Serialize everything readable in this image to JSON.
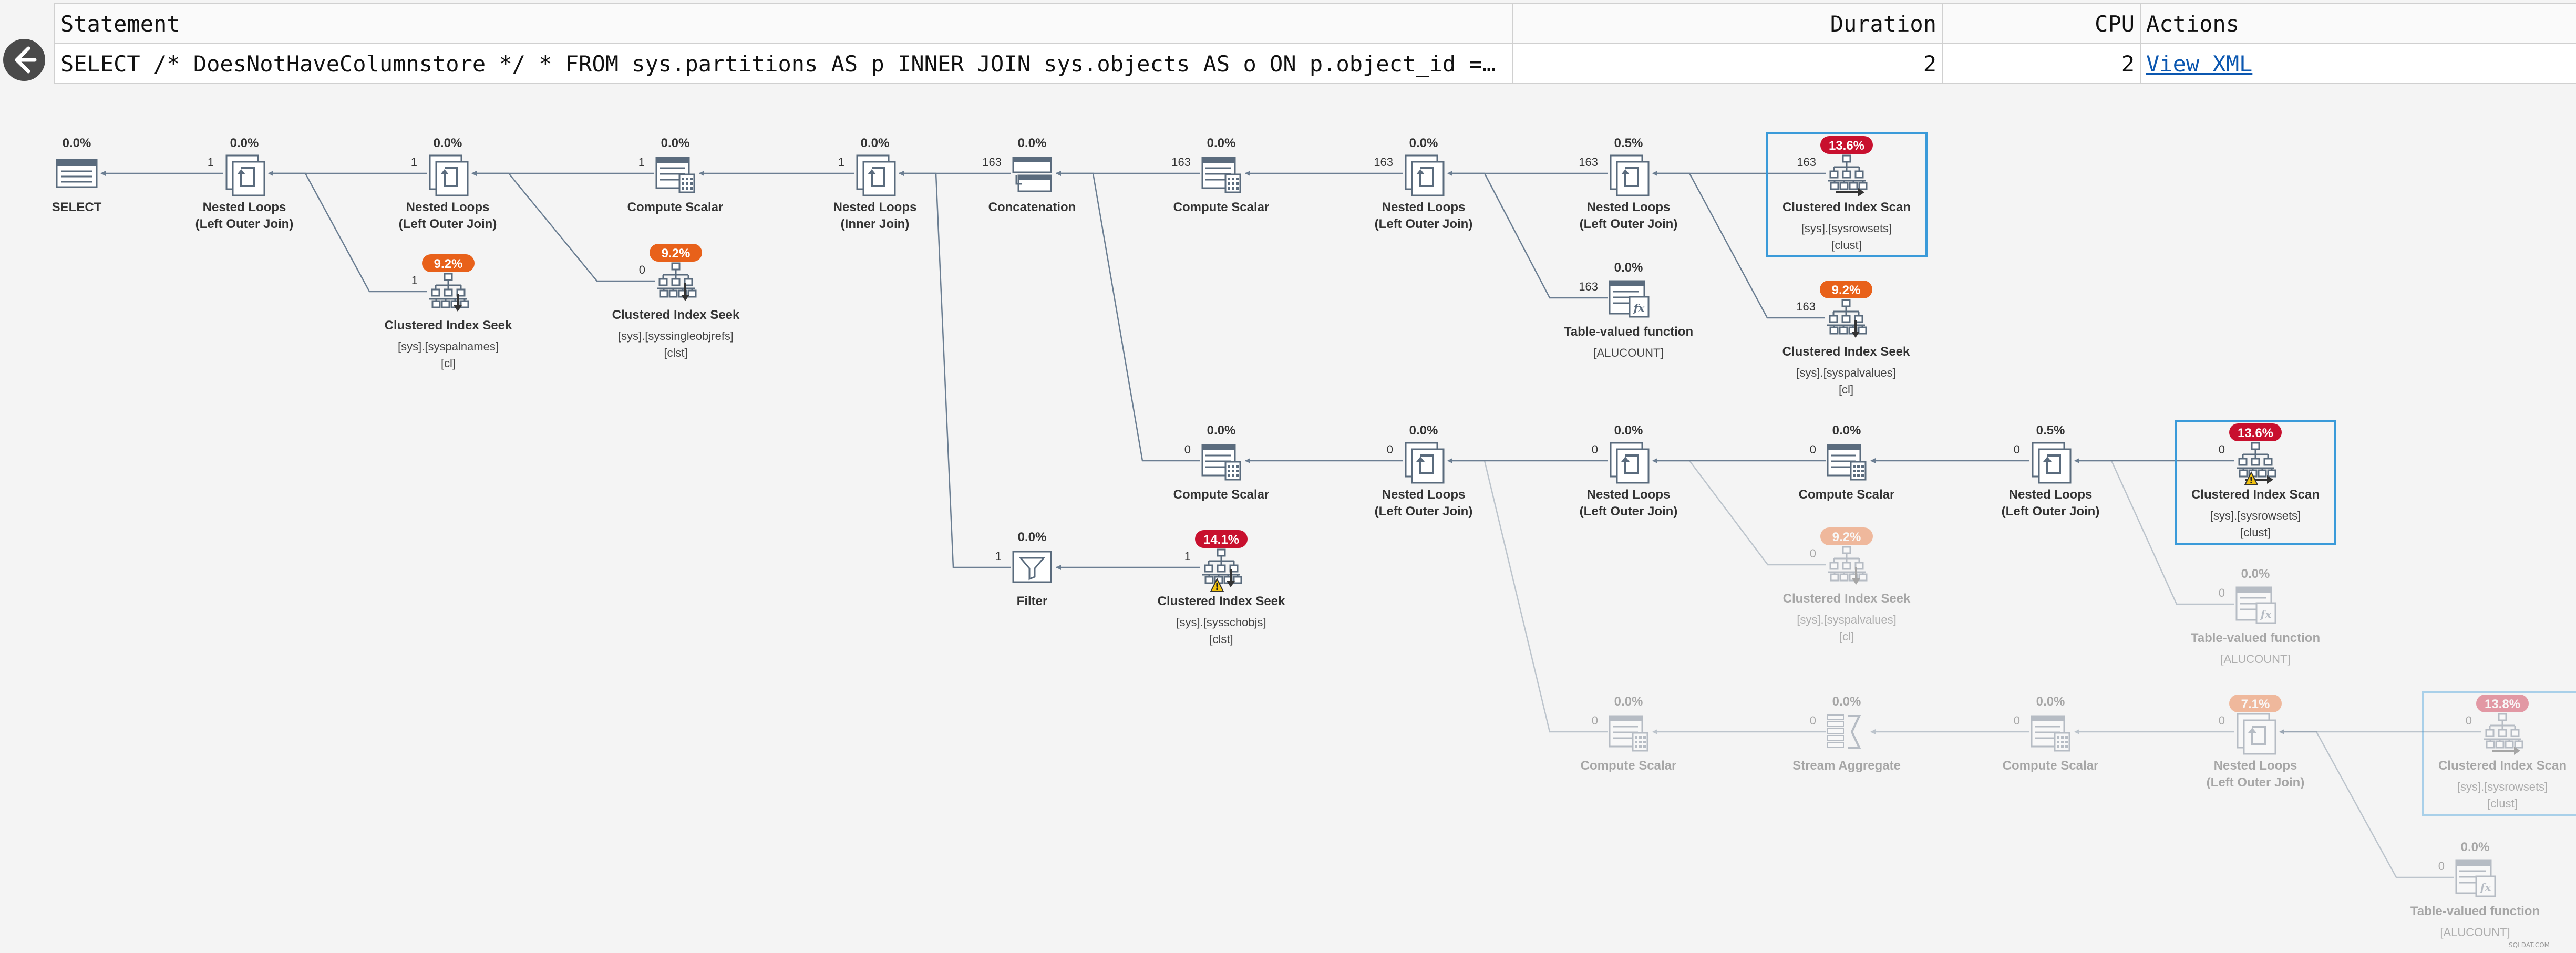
{
  "statement_table": {
    "headers": {
      "statement": "Statement",
      "duration": "Duration",
      "cpu": "CPU",
      "actions": "Actions"
    },
    "row": {
      "statement": "SELECT /* DoesNotHaveColumnstore */ * FROM sys.partitions AS p INNER JOIN sys.objects AS o ON p.object_id = o.object_id …",
      "duration": "2",
      "cpu": "2",
      "action_link": "View XML"
    }
  },
  "colors": {
    "badge_red": "#c8102e",
    "badge_orange": "#e8611a",
    "highlight_border": "#3a9ad9",
    "edge": "#6b7e92",
    "icon_stroke": "#5a6b7d"
  },
  "watermark": "SQLDAT.COM",
  "nodes": [
    {
      "id": "select",
      "icon": "select-icon",
      "pct": "0.0%",
      "lines": [
        "SELECT"
      ],
      "details": []
    },
    {
      "id": "nl1",
      "icon": "nested-loops-icon",
      "pct": "0.0%",
      "lines": [
        "Nested Loops",
        "(Left Outer Join)"
      ],
      "details": []
    },
    {
      "id": "nl2",
      "icon": "nested-loops-icon",
      "pct": "0.0%",
      "lines": [
        "Nested Loops",
        "(Left Outer Join)"
      ],
      "details": []
    },
    {
      "id": "cs1",
      "icon": "compute-scalar-icon",
      "pct": "0.0%",
      "lines": [
        "Compute Scalar"
      ],
      "details": []
    },
    {
      "id": "nl3",
      "icon": "nested-loops-icon",
      "pct": "0.0%",
      "lines": [
        "Nested Loops",
        "(Inner Join)"
      ],
      "details": []
    },
    {
      "id": "concat",
      "icon": "concatenation-icon",
      "pct": "0.0%",
      "lines": [
        "Concatenation"
      ],
      "details": []
    },
    {
      "id": "cs2",
      "icon": "compute-scalar-icon",
      "pct": "0.0%",
      "lines": [
        "Compute Scalar"
      ],
      "details": []
    },
    {
      "id": "nl4",
      "icon": "nested-loops-icon",
      "pct": "0.0%",
      "lines": [
        "Nested Loops",
        "(Left Outer Join)"
      ],
      "details": []
    },
    {
      "id": "nl5",
      "icon": "nested-loops-icon",
      "pct": "0.5%",
      "lines": [
        "Nested Loops",
        "(Left Outer Join)"
      ],
      "details": []
    },
    {
      "id": "cis1",
      "icon": "clustered-index-scan-icon",
      "pct": "13.6%",
      "badge": "red",
      "highlight": true,
      "lines": [
        "Clustered Index Scan"
      ],
      "details": [
        "[sys].[sysrowsets]",
        "[clust]"
      ]
    },
    {
      "id": "seek1",
      "icon": "clustered-index-seek-icon",
      "pct": "9.2%",
      "badge": "orange",
      "lines": [
        "Clustered Index Seek"
      ],
      "details": [
        "[sys].[syspalnames]",
        "[cl]"
      ]
    },
    {
      "id": "seek2",
      "icon": "clustered-index-seek-icon",
      "pct": "9.2%",
      "badge": "orange",
      "lines": [
        "Clustered Index Seek"
      ],
      "details": [
        "[sys].[syssingleobjrefs]",
        "[clst]"
      ]
    },
    {
      "id": "tvf1",
      "icon": "table-valued-function-icon",
      "pct": "0.0%",
      "lines": [
        "Table-valued function"
      ],
      "details": [
        "[ALUCOUNT]"
      ]
    },
    {
      "id": "seek3",
      "icon": "clustered-index-seek-icon",
      "pct": "9.2%",
      "badge": "orange",
      "lines": [
        "Clustered Index Seek"
      ],
      "details": [
        "[sys].[syspalvalues]",
        "[cl]"
      ]
    },
    {
      "id": "cs3",
      "icon": "compute-scalar-icon",
      "pct": "0.0%",
      "lines": [
        "Compute Scalar"
      ],
      "details": []
    },
    {
      "id": "nl6",
      "icon": "nested-loops-icon",
      "pct": "0.0%",
      "lines": [
        "Nested Loops",
        "(Left Outer Join)"
      ],
      "details": []
    },
    {
      "id": "nl7",
      "icon": "nested-loops-icon",
      "pct": "0.0%",
      "lines": [
        "Nested Loops",
        "(Left Outer Join)"
      ],
      "details": []
    },
    {
      "id": "cs4",
      "icon": "compute-scalar-icon",
      "pct": "0.0%",
      "lines": [
        "Compute Scalar"
      ],
      "details": []
    },
    {
      "id": "nl8",
      "icon": "nested-loops-icon",
      "pct": "0.5%",
      "lines": [
        "Nested Loops",
        "(Left Outer Join)"
      ],
      "details": []
    },
    {
      "id": "cis2",
      "icon": "clustered-index-scan-icon",
      "pct": "13.6%",
      "badge": "red",
      "highlight": true,
      "warning": true,
      "lines": [
        "Clustered Index Scan"
      ],
      "details": [
        "[sys].[sysrowsets]",
        "[clust]"
      ]
    },
    {
      "id": "filter",
      "icon": "filter-icon",
      "pct": "0.0%",
      "lines": [
        "Filter"
      ],
      "details": []
    },
    {
      "id": "seek4",
      "icon": "clustered-index-seek-icon",
      "pct": "14.1%",
      "badge": "red",
      "warning": true,
      "lines": [
        "Clustered Index Seek"
      ],
      "details": [
        "[sys].[sysschobjs]",
        "[clst]"
      ]
    },
    {
      "id": "seek5",
      "icon": "clustered-index-seek-icon",
      "pct": "9.2%",
      "badge": "orange",
      "faded": true,
      "lines": [
        "Clustered Index Seek"
      ],
      "details": [
        "[sys].[syspalvalues]",
        "[cl]"
      ]
    },
    {
      "id": "tvf2",
      "icon": "table-valued-function-icon",
      "pct": "0.0%",
      "faded": true,
      "lines": [
        "Table-valued function"
      ],
      "details": [
        "[ALUCOUNT]"
      ]
    },
    {
      "id": "cs5",
      "icon": "compute-scalar-icon",
      "pct": "0.0%",
      "faded": true,
      "lines": [
        "Compute Scalar"
      ],
      "details": []
    },
    {
      "id": "sa",
      "icon": "stream-aggregate-icon",
      "pct": "0.0%",
      "faded": true,
      "lines": [
        "Stream Aggregate"
      ],
      "details": []
    },
    {
      "id": "cs6",
      "icon": "compute-scalar-icon",
      "pct": "0.0%",
      "faded": true,
      "lines": [
        "Compute Scalar"
      ],
      "details": []
    },
    {
      "id": "nl9",
      "icon": "nested-loops-icon",
      "pct": "7.1%",
      "badge": "orange",
      "faded": true,
      "lines": [
        "Nested Loops",
        "(Left Outer Join)"
      ],
      "details": []
    },
    {
      "id": "cis3",
      "icon": "clustered-index-scan-icon",
      "pct": "13.8%",
      "badge": "red",
      "highlight": true,
      "faded": true,
      "lines": [
        "Clustered Index Scan"
      ],
      "details": [
        "[sys].[sysrowsets]",
        "[clust]"
      ]
    },
    {
      "id": "tvf3",
      "icon": "table-valued-function-icon",
      "pct": "0.0%",
      "faded": true,
      "lines": [
        "Table-valued function"
      ],
      "details": [
        "[ALUCOUNT]"
      ]
    }
  ],
  "edges": [
    {
      "from": "nl1",
      "to": "select",
      "rows": "1"
    },
    {
      "from": "nl2",
      "to": "nl1",
      "rows": "1"
    },
    {
      "from": "seek1",
      "to": "nl1",
      "rows": "1"
    },
    {
      "from": "cs1",
      "to": "nl2",
      "rows": "1"
    },
    {
      "from": "seek2",
      "to": "nl2",
      "rows": "0"
    },
    {
      "from": "nl3",
      "to": "cs1",
      "rows": "1"
    },
    {
      "from": "concat",
      "to": "nl3",
      "rows": "163"
    },
    {
      "from": "filter",
      "to": "nl3",
      "rows": "1"
    },
    {
      "from": "cs2",
      "to": "concat",
      "rows": "163"
    },
    {
      "from": "cs3",
      "to": "concat",
      "rows": "0"
    },
    {
      "from": "nl4",
      "to": "cs2",
      "rows": "163"
    },
    {
      "from": "nl5",
      "to": "nl4",
      "rows": "163"
    },
    {
      "from": "tvf1",
      "to": "nl4",
      "rows": "163"
    },
    {
      "from": "cis1",
      "to": "nl5",
      "rows": "163"
    },
    {
      "from": "seek3",
      "to": "nl5",
      "rows": "163"
    },
    {
      "from": "nl6",
      "to": "cs3",
      "rows": "0"
    },
    {
      "from": "nl7",
      "to": "nl6",
      "rows": "0"
    },
    {
      "from": "cs5",
      "to": "nl6",
      "rows": "0"
    },
    {
      "from": "cs4",
      "to": "nl7",
      "rows": "0"
    },
    {
      "from": "seek5",
      "to": "nl7",
      "rows": "0"
    },
    {
      "from": "nl8",
      "to": "cs4",
      "rows": "0"
    },
    {
      "from": "cis2",
      "to": "nl8",
      "rows": "0"
    },
    {
      "from": "tvf2",
      "to": "nl8",
      "rows": "0"
    },
    {
      "from": "seek4",
      "to": "filter",
      "rows": "1"
    },
    {
      "from": "sa",
      "to": "cs5",
      "rows": "0"
    },
    {
      "from": "cs6",
      "to": "sa",
      "rows": "0"
    },
    {
      "from": "nl9",
      "to": "cs6",
      "rows": "0"
    },
    {
      "from": "cis3",
      "to": "nl9",
      "rows": "0"
    },
    {
      "from": "tvf3",
      "to": "nl9",
      "rows": "0"
    }
  ]
}
